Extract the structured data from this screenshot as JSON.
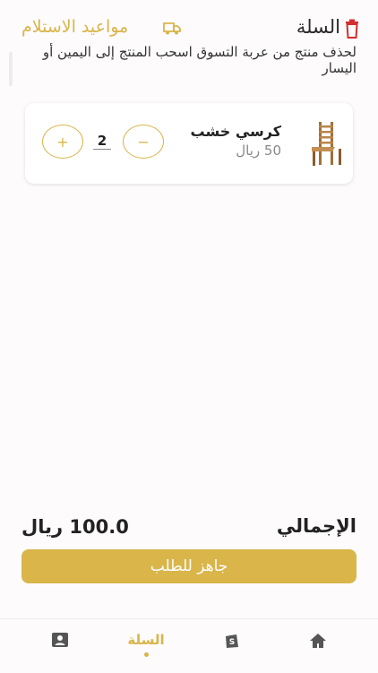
{
  "header": {
    "title": "السلة",
    "pickup_link": "مواعيد الاستلام"
  },
  "hint": "لحذف منتج من عربة التسوق اسحب المنتج إلى اليمين أو اليسار",
  "cart": {
    "items": [
      {
        "name": "كرسي خشب",
        "price": "50 ريال",
        "quantity": "2",
        "minus": "−",
        "plus": "+"
      }
    ]
  },
  "summary": {
    "total_label": "الإجمالي",
    "total_value": "100.0 ريال",
    "order_button": "جاهز للطلب"
  },
  "nav": {
    "cart_label": "السلة",
    "active": "cart"
  },
  "colors": {
    "accent": "#d9b54a",
    "trash": "#d32f2f",
    "nav_icon": "#555555"
  }
}
